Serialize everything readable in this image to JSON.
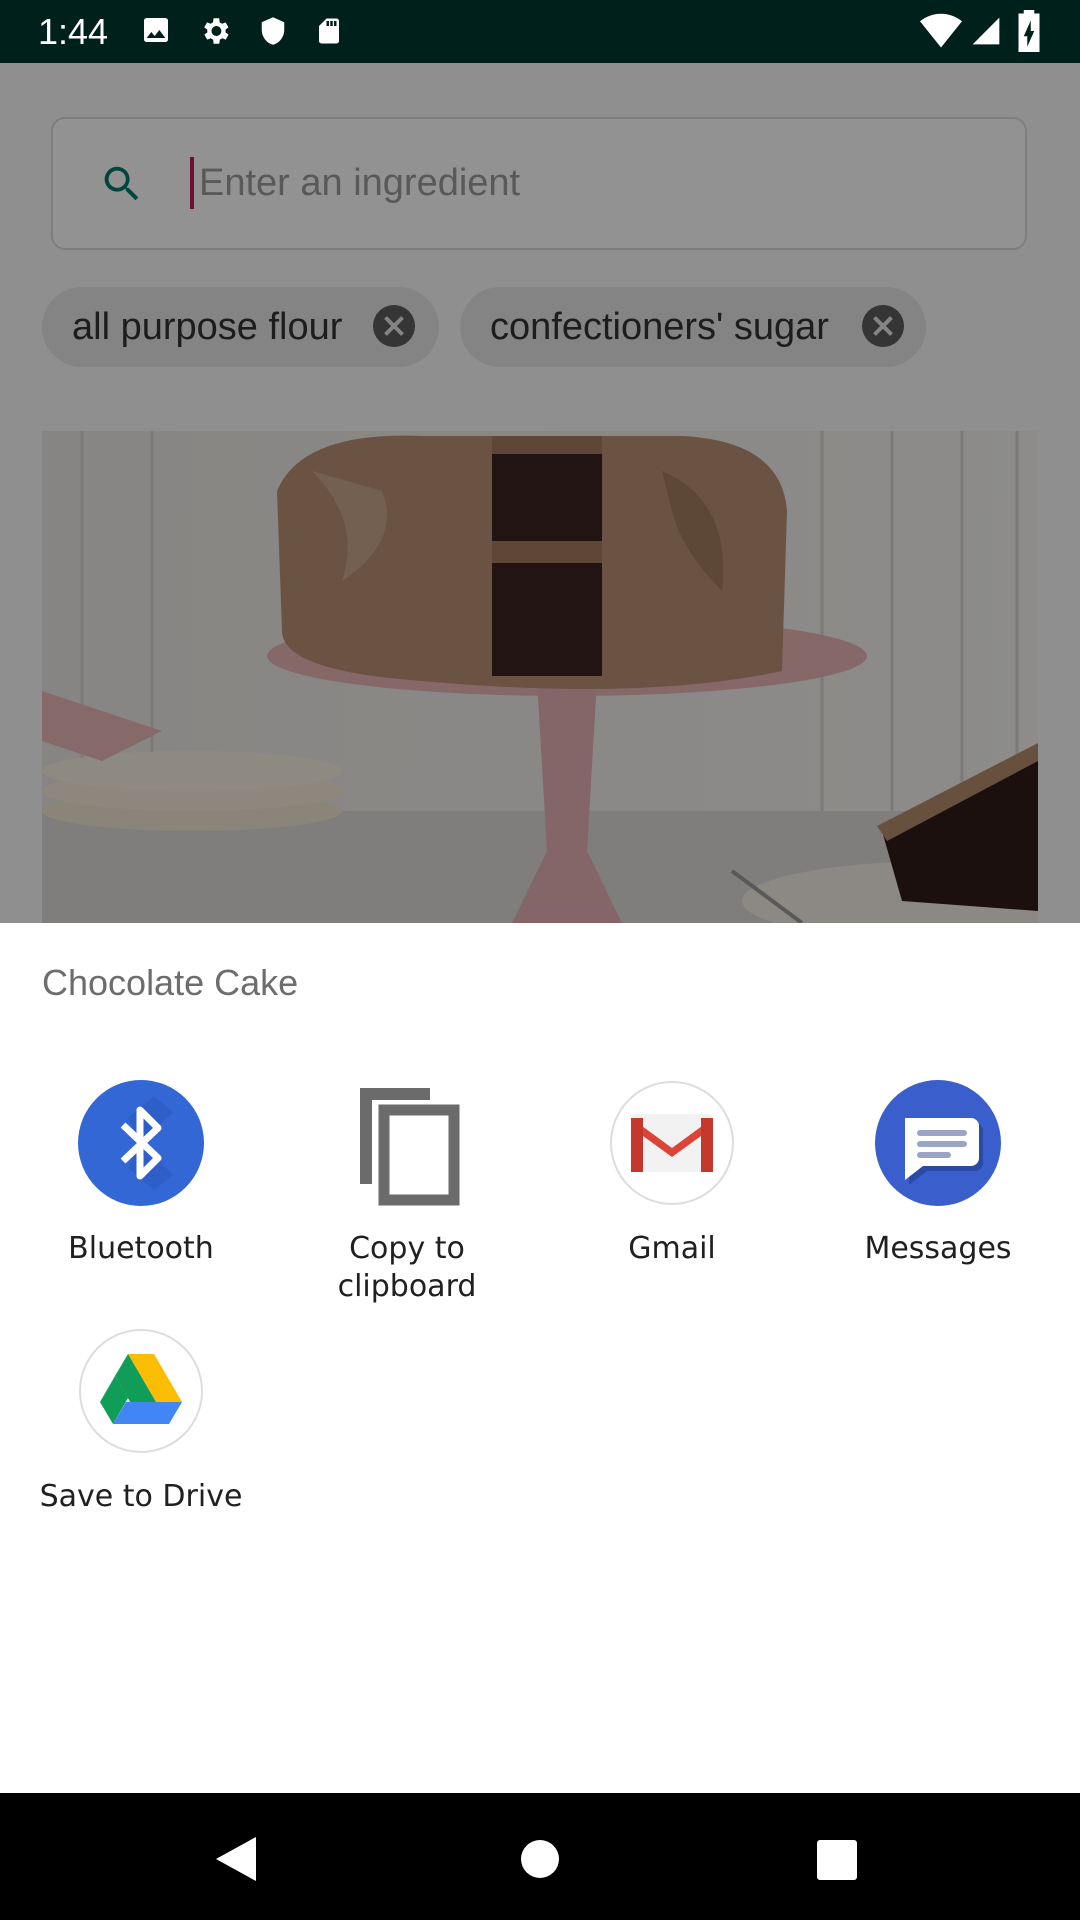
{
  "status_bar": {
    "time": "1:44",
    "icons_left": [
      "image-icon",
      "settings-icon",
      "shield-icon",
      "sd-card-icon"
    ],
    "icons_right": [
      "wifi-icon",
      "signal-icon",
      "battery-charging-icon"
    ]
  },
  "app": {
    "search": {
      "placeholder": "Enter an ingredient"
    },
    "chips": [
      {
        "label": "all purpose flour"
      },
      {
        "label": "confectioners' sugar"
      }
    ],
    "image": "chocolate-cake-photo"
  },
  "share_sheet": {
    "title": "Chocolate Cake",
    "targets": [
      {
        "label": "Bluetooth",
        "icon": "bluetooth-icon"
      },
      {
        "label": "Copy to clipboard",
        "icon": "copy-icon"
      },
      {
        "label": "Gmail",
        "icon": "gmail-icon"
      },
      {
        "label": "Messages",
        "icon": "messages-icon"
      },
      {
        "label": "Save to Drive",
        "icon": "drive-icon"
      }
    ]
  },
  "nav_bar": {
    "buttons": [
      "back-icon",
      "home-icon",
      "recents-icon"
    ]
  },
  "colors": {
    "status_bar": "#00201c",
    "scrim": "#000000",
    "bluetooth": "#3367d6",
    "messages": "#3a5fcd",
    "gmail_red": "#db4437"
  }
}
